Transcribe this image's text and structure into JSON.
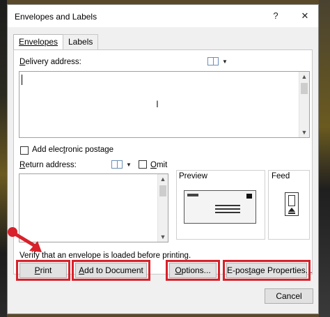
{
  "window": {
    "title": "Envelopes and Labels",
    "help_glyph": "?",
    "close_glyph": "✕"
  },
  "tabs": [
    {
      "label": "Envelopes"
    },
    {
      "label": "Labels"
    }
  ],
  "delivery": {
    "label_prefix": "D",
    "label_rest": "elivery address:",
    "value": ""
  },
  "epostage": {
    "label_pre": "Add elec",
    "label_u": "t",
    "label_post": "ronic postage",
    "checked": false
  },
  "return": {
    "label_prefix": "R",
    "label_rest": "eturn address:",
    "omit_pre": "",
    "omit_u": "O",
    "omit_post": "mit",
    "value": ""
  },
  "preview": {
    "label": "Preview"
  },
  "feed": {
    "label": "Feed"
  },
  "verify_text": "Verify that an envelope is loaded before printing.",
  "buttons": {
    "print_u": "P",
    "print_rest": "rint",
    "add_pre": "",
    "add_u": "A",
    "add_rest": "dd to Document",
    "options_u": "O",
    "options_rest": "ptions...",
    "epostage_pre": "E-pos",
    "epostage_u": "t",
    "epostage_rest": "age Properties...",
    "cancel": "Cancel"
  },
  "colors": {
    "highlight": "#d8212a",
    "dialog_bg": "#f0f0f0",
    "book_icon": "#6a8fb5"
  },
  "icons": {
    "address_book": "address-book-icon",
    "dropdown": "chevron-down-icon"
  }
}
